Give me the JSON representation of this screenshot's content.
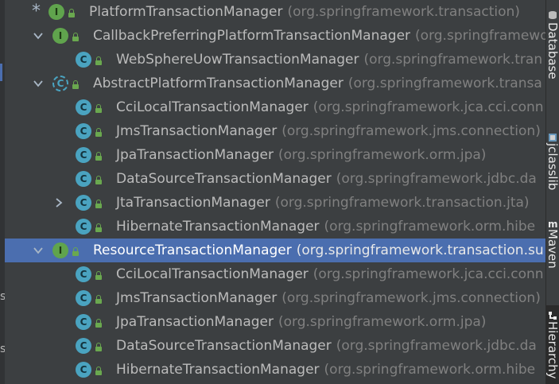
{
  "tree": {
    "rows": [
      {
        "indent": 0,
        "expand": "",
        "star": "*",
        "kind": "interface",
        "letter": "I",
        "name": "PlatformTransactionManager",
        "pkg": "(org.springframework.transaction)"
      },
      {
        "indent": 1,
        "expand": "expanded",
        "kind": "interface",
        "letter": "I",
        "name": "CallbackPreferringPlatformTransactionManager",
        "pkg": "(org.springframework"
      },
      {
        "indent": 2,
        "expand": "",
        "kind": "class",
        "letter": "C",
        "name": "WebSphereUowTransactionManager",
        "pkg": "(org.springframework.tran"
      },
      {
        "indent": 1,
        "expand": "expanded",
        "kind": "abstract",
        "letter": "C",
        "name": "AbstractPlatformTransactionManager",
        "pkg": "(org.springframework.transa"
      },
      {
        "indent": 2,
        "expand": "",
        "kind": "class",
        "letter": "C",
        "name": "CciLocalTransactionManager",
        "pkg": "(org.springframework.jca.cci.conn"
      },
      {
        "indent": 2,
        "expand": "",
        "kind": "class",
        "letter": "C",
        "name": "JmsTransactionManager",
        "pkg": "(org.springframework.jms.connection)"
      },
      {
        "indent": 2,
        "expand": "",
        "kind": "class",
        "letter": "C",
        "name": "JpaTransactionManager",
        "pkg": "(org.springframework.orm.jpa)"
      },
      {
        "indent": 2,
        "expand": "",
        "kind": "class",
        "letter": "C",
        "name": "DataSourceTransactionManager",
        "pkg": "(org.springframework.jdbc.da"
      },
      {
        "indent": 2,
        "expand": "collapsed",
        "kind": "class",
        "letter": "C",
        "name": "JtaTransactionManager",
        "pkg": "(org.springframework.transaction.jta)"
      },
      {
        "indent": 2,
        "expand": "",
        "kind": "class",
        "letter": "C",
        "name": "HibernateTransactionManager",
        "pkg": "(org.springframework.orm.hibe"
      },
      {
        "indent": 1,
        "expand": "expanded",
        "selected": true,
        "kind": "interface",
        "letter": "I",
        "name": "ResourceTransactionManager",
        "pkg": "(org.springframework.transaction.su"
      },
      {
        "indent": 2,
        "expand": "",
        "kind": "class",
        "letter": "C",
        "name": "CciLocalTransactionManager",
        "pkg": "(org.springframework.jca.cci.conn"
      },
      {
        "indent": 2,
        "expand": "",
        "kind": "class",
        "letter": "C",
        "name": "JmsTransactionManager",
        "pkg": "(org.springframework.jms.connection)"
      },
      {
        "indent": 2,
        "expand": "",
        "kind": "class",
        "letter": "C",
        "name": "JpaTransactionManager",
        "pkg": "(org.springframework.orm.jpa)"
      },
      {
        "indent": 2,
        "expand": "",
        "kind": "class",
        "letter": "C",
        "name": "DataSourceTransactionManager",
        "pkg": "(org.springframework.jdbc.da"
      },
      {
        "indent": 2,
        "expand": "",
        "kind": "class",
        "letter": "C",
        "name": "HibernateTransactionManager",
        "pkg": "(org.springframework.orm.hibe"
      }
    ]
  },
  "left_edge": {
    "chars": [
      "s",
      "s"
    ]
  },
  "side_tabs": [
    {
      "label": "Database",
      "icon": "database-icon"
    },
    {
      "label": "jclasslib",
      "icon": "jclasslib-icon"
    },
    {
      "label": "Maven",
      "icon": "maven-icon"
    },
    {
      "label": "Hierarchy",
      "icon": "hierarchy-icon",
      "active": true
    }
  ],
  "colors": {
    "background": "#3c3f41",
    "selection": "#4b6eaf",
    "interface_icon": "#60a44d",
    "class_icon": "#4aa3c0",
    "text": "#bbbbbb",
    "package_text": "#808080"
  }
}
